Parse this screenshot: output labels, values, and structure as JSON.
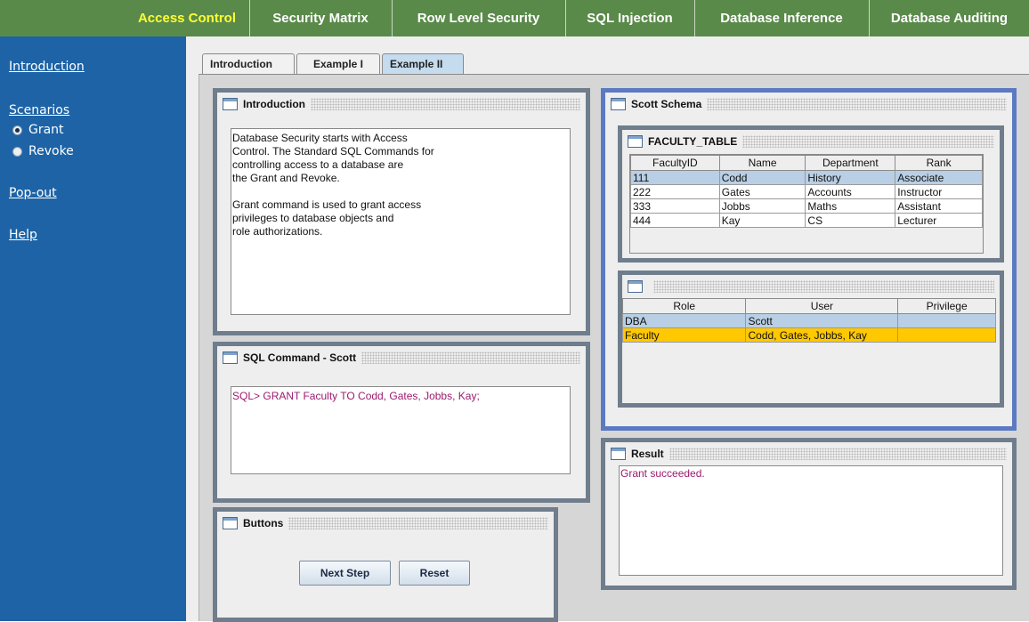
{
  "nav": {
    "items": [
      {
        "label": "Access Control"
      },
      {
        "label": "Security Matrix"
      },
      {
        "label": "Row Level Security"
      },
      {
        "label": "SQL Injection"
      },
      {
        "label": "Database Inference"
      },
      {
        "label": "Database Auditing"
      }
    ],
    "active_index": 0
  },
  "sidebar": {
    "introduction": "Introduction",
    "scenarios": "Scenarios",
    "grant": "Grant",
    "revoke": "Revoke",
    "selected_scenario": "Grant",
    "popout": "Pop-out",
    "help": "Help"
  },
  "tabs": [
    {
      "label": "Introduction"
    },
    {
      "label": "Example I"
    },
    {
      "label": "Example II"
    }
  ],
  "active_tab": "Example II",
  "intro_frame": {
    "title": "Introduction",
    "text": "Database Security starts with Access\nControl. The Standard SQL Commands for\ncontrolling access to a database are\nthe Grant and Revoke.\n\nGrant command is used to grant access\nprivileges to database objects and\nrole authorizations."
  },
  "sql_frame": {
    "title": "SQL Command - Scott",
    "command": "SQL> GRANT Faculty TO Codd, Gates, Jobbs, Kay;"
  },
  "buttons_frame": {
    "title": "Buttons",
    "next_step": "Next Step",
    "reset": "Reset"
  },
  "schema_frame": {
    "title": "Scott Schema",
    "faculty_table": {
      "title": "FACULTY_TABLE",
      "columns": [
        "FacultyID",
        "Name",
        "Department",
        "Rank"
      ],
      "rows": [
        [
          "111",
          "Codd",
          "History",
          "Associate"
        ],
        [
          "222",
          "Gates",
          "Accounts",
          "Instructor"
        ],
        [
          "333",
          "Jobbs",
          "Maths",
          "Assistant"
        ],
        [
          "444",
          "Kay",
          "CS",
          "Lecturer"
        ]
      ],
      "selected_row": 0
    },
    "role_table": {
      "title": "",
      "columns": [
        "Role",
        "User",
        "Privilege"
      ],
      "rows": [
        [
          "DBA",
          "Scott",
          ""
        ],
        [
          "Faculty",
          "Codd, Gates, Jobbs, Kay",
          ""
        ]
      ],
      "highlight_colors": [
        "#b8cfe5",
        "#ffc800"
      ]
    }
  },
  "result_frame": {
    "title": "Result",
    "text": "Grant succeeded."
  },
  "colors": {
    "nav_bg": "#5a8a4a",
    "nav_active": "#ffff33",
    "sidebar_bg": "#1d63a6",
    "frame_border": "#6f7d8d",
    "schema_border": "#5b7ac2",
    "message": "#9c1a6e"
  }
}
